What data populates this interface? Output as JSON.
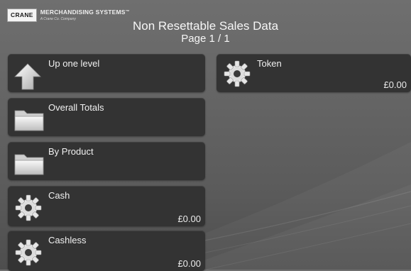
{
  "header": {
    "logo_brand": "CRANE",
    "logo_name": "MERCHANDISING SYSTEMS",
    "logo_tm": "™",
    "logo_sub": "A Crane Co. Company",
    "title": "Non Resettable Sales Data",
    "page": "Page 1 / 1"
  },
  "menu": {
    "up": {
      "label": "Up one level",
      "icon": "up-arrow-icon"
    },
    "overall": {
      "label": "Overall Totals",
      "icon": "folder-icon"
    },
    "product": {
      "label": "By Product",
      "icon": "folder-icon"
    },
    "cash": {
      "label": "Cash",
      "value": "£0.00",
      "icon": "gear-icon"
    },
    "cashless": {
      "label": "Cashless",
      "value": "£0.00",
      "icon": "gear-icon"
    },
    "token": {
      "label": "Token",
      "value": "£0.00",
      "icon": "gear-icon"
    }
  }
}
